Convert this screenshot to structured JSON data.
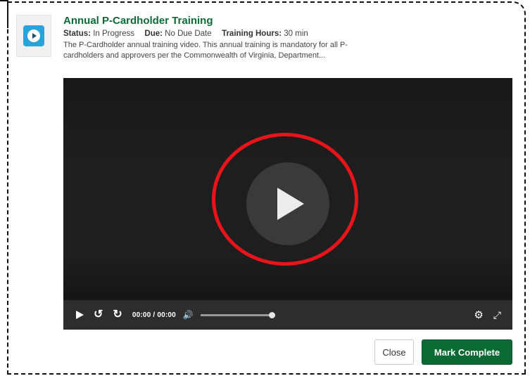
{
  "training": {
    "title": "Annual P-Cardholder Training",
    "status_label": "Status:",
    "status_value": "In Progress",
    "due_label": "Due:",
    "due_value": "No Due Date",
    "hours_label": "Training Hours:",
    "hours_value": "30 min",
    "description": "The P-Cardholder annual training video. This annual training is mandatory for all P-cardholders and approvers per the Commonwealth of Virginia, Department..."
  },
  "player": {
    "time": "00:00 / 00:00",
    "volume_level": 1.0,
    "icons": [
      "play-icon",
      "rewind-icon",
      "forward-icon",
      "volume-icon",
      "gear-icon",
      "fullscreen-icon"
    ]
  },
  "buttons": {
    "close": "Close",
    "mark_complete": "Mark Complete"
  },
  "colors": {
    "title_green": "#0d6b36",
    "primary_button": "#0b6a34",
    "annotation_red": "#e8141a",
    "thumbnail_blue": "#2aa3d8"
  }
}
